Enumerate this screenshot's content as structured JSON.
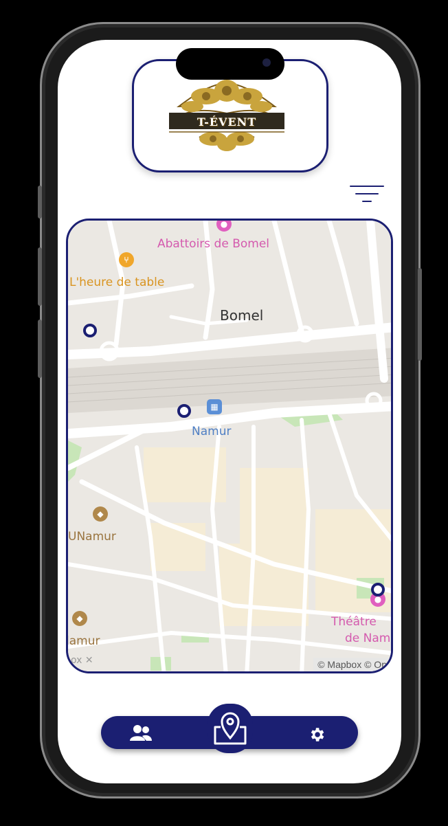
{
  "app": {
    "logo_text": "T-ÉVENT"
  },
  "map": {
    "labels": {
      "abattoirs": "Abattoirs de Bomel",
      "heure_de_table": "L'heure de table",
      "bomel": "Bomel",
      "namur_station": "Namur",
      "unamur": "UNamur",
      "namur_cut": "lamur",
      "theatre_line1": "Théâtre",
      "theatre_line2": "de Nam"
    },
    "attribution": "© Mapbox © Op",
    "attribution_partial": "ox ✕",
    "colors": {
      "background": "#f2efe9",
      "road": "#ffffff",
      "park": "#c8e6b8",
      "rail": "#dcd8d2",
      "urban": "#f5ecd6",
      "poi_pink": "#e05fbf",
      "poi_orange": "#f0a62b",
      "poi_brown": "#b0884b",
      "transit": "#5b8fd6"
    }
  },
  "nav": {
    "items": [
      {
        "name": "users",
        "icon": "users-icon"
      },
      {
        "name": "map",
        "icon": "map-pin-icon",
        "active": true
      },
      {
        "name": "settings",
        "icon": "gear-icon"
      }
    ]
  },
  "theme": {
    "accent": "#1b1f72"
  }
}
